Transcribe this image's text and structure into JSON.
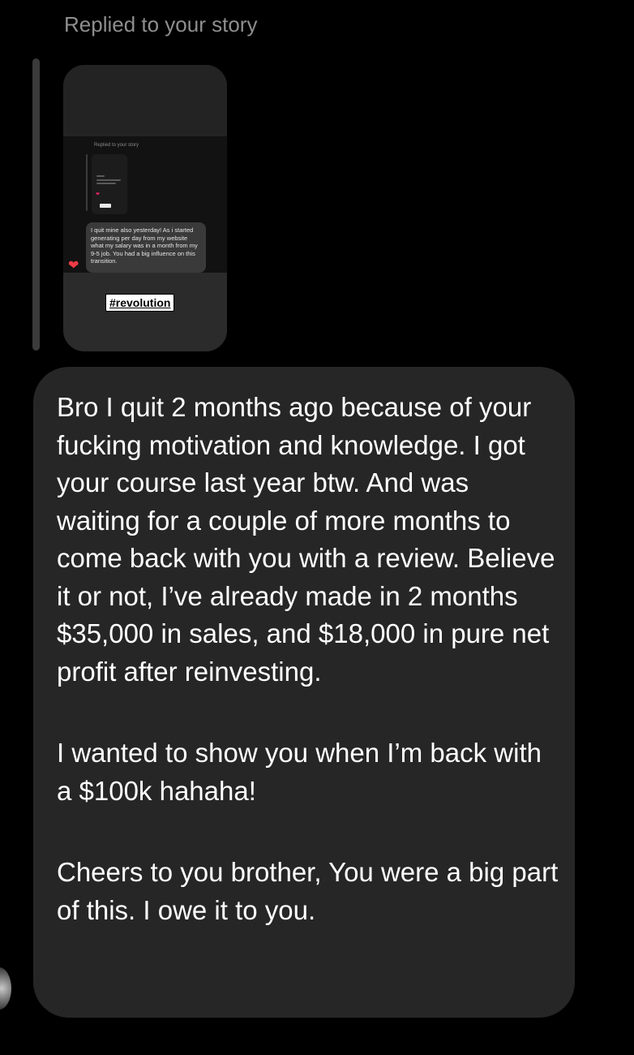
{
  "reply_header": "Replied to your story",
  "story": {
    "nested_header": "Replied to your story",
    "nested_reply_text": "I quit mine also yesterday! As i started generating per day from my website what my salary was in a month from my 9-5 job. You had a big influence on this transition.",
    "nested_reaction": "❤",
    "hashtag": "#revolution"
  },
  "message": {
    "paragraphs": [
      "Bro I quit 2 months ago because of your fucking motivation and knowledge. I got your course last year btw. And was waiting for a couple of more months to come back with you with a review. Believe it or not, I’ve already made in 2 months $35,000 in sales, and $18,000 in pure net profit after reinvesting.",
      "I wanted to show you when I’m back with a $100k hahaha!",
      "Cheers to you brother, You were a big part of this. I owe it to you."
    ]
  },
  "colors": {
    "background": "#000000",
    "bubble": "#262626",
    "secondary_text": "#8e8e8e",
    "heart": "#f23b45"
  },
  "icons": {
    "reaction": "heart-icon",
    "avatar": "avatar"
  }
}
